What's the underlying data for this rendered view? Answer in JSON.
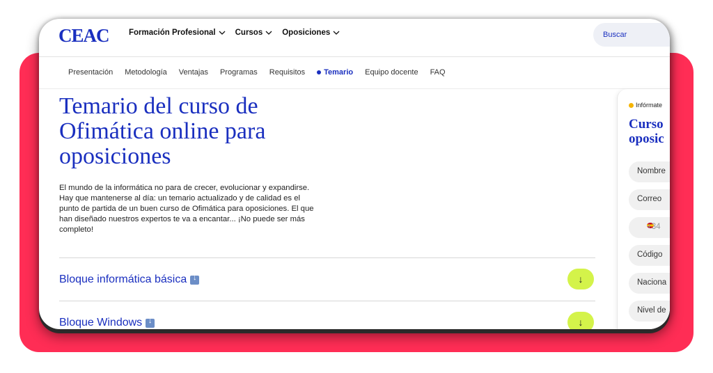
{
  "header": {
    "logo": "CEAC",
    "nav": [
      "Formación Profesional",
      "Cursos",
      "Oposiciones"
    ],
    "search_label": "Buscar"
  },
  "subnav": {
    "items": [
      "Presentación",
      "Metodología",
      "Ventajas",
      "Programas",
      "Requisitos"
    ],
    "active": "Temario",
    "after": [
      "Equipo docente",
      "FAQ"
    ]
  },
  "main": {
    "title": "Temario del curso de Ofimática online para oposiciones",
    "intro": "El mundo de la informática no para de crecer, evolucionar y expandirse. Hay que mantenerse al día: un temario actualizado y de calidad es el punto de partida de un buen curso de Ofimática para oposiciones. El que han diseñado nuestros expertos te va a encantar... ¡No puede ser más completo!",
    "blocks": [
      "Bloque informática básica",
      "Bloque Windows"
    ]
  },
  "side_form": {
    "tag": "Infórmate",
    "title": "Curso oposic",
    "fields": [
      "Nombre",
      "Correo",
      "+34",
      "Código",
      "Naciona",
      "Nivel de"
    ]
  },
  "colors": {
    "brand_blue": "#1a2fbf",
    "accent_red": "#ff2d55",
    "expand_green": "#d4f34a"
  }
}
